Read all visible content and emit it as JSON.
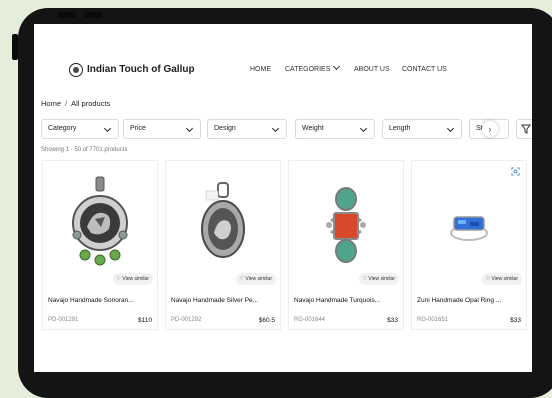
{
  "brand": {
    "name": "Indian Touch of Gallup"
  },
  "nav": {
    "items": [
      "HOME",
      "CATEGORIES",
      "ABOUT US",
      "CONTACT US"
    ]
  },
  "breadcrumb": {
    "home": "Home",
    "separator": "/",
    "current": "All products"
  },
  "filters": [
    "Category",
    "Price",
    "Design",
    "Weight",
    "Length",
    "Stor"
  ],
  "results": {
    "count_text": "Showing 1 - 50 of 7701 products"
  },
  "product_card": {
    "view_similar_label": "View similar"
  },
  "products": [
    {
      "name": "Navajo Handmade Sonoran...",
      "sku": "PD-001291",
      "price": "$110"
    },
    {
      "name": "Navajo Handmade Silver Pe...",
      "sku": "PD-001292",
      "price": "$60.5"
    },
    {
      "name": "Navajo Handmade Turquois...",
      "sku": "RG-001644",
      "price": "$33"
    },
    {
      "name": "Zuni Handmade Opal Ring ...",
      "sku": "RG-001651",
      "price": "$33"
    }
  ],
  "colors": {
    "background": "#e5eedb",
    "device": "#141414",
    "accent_icon": "#4a86c8"
  }
}
